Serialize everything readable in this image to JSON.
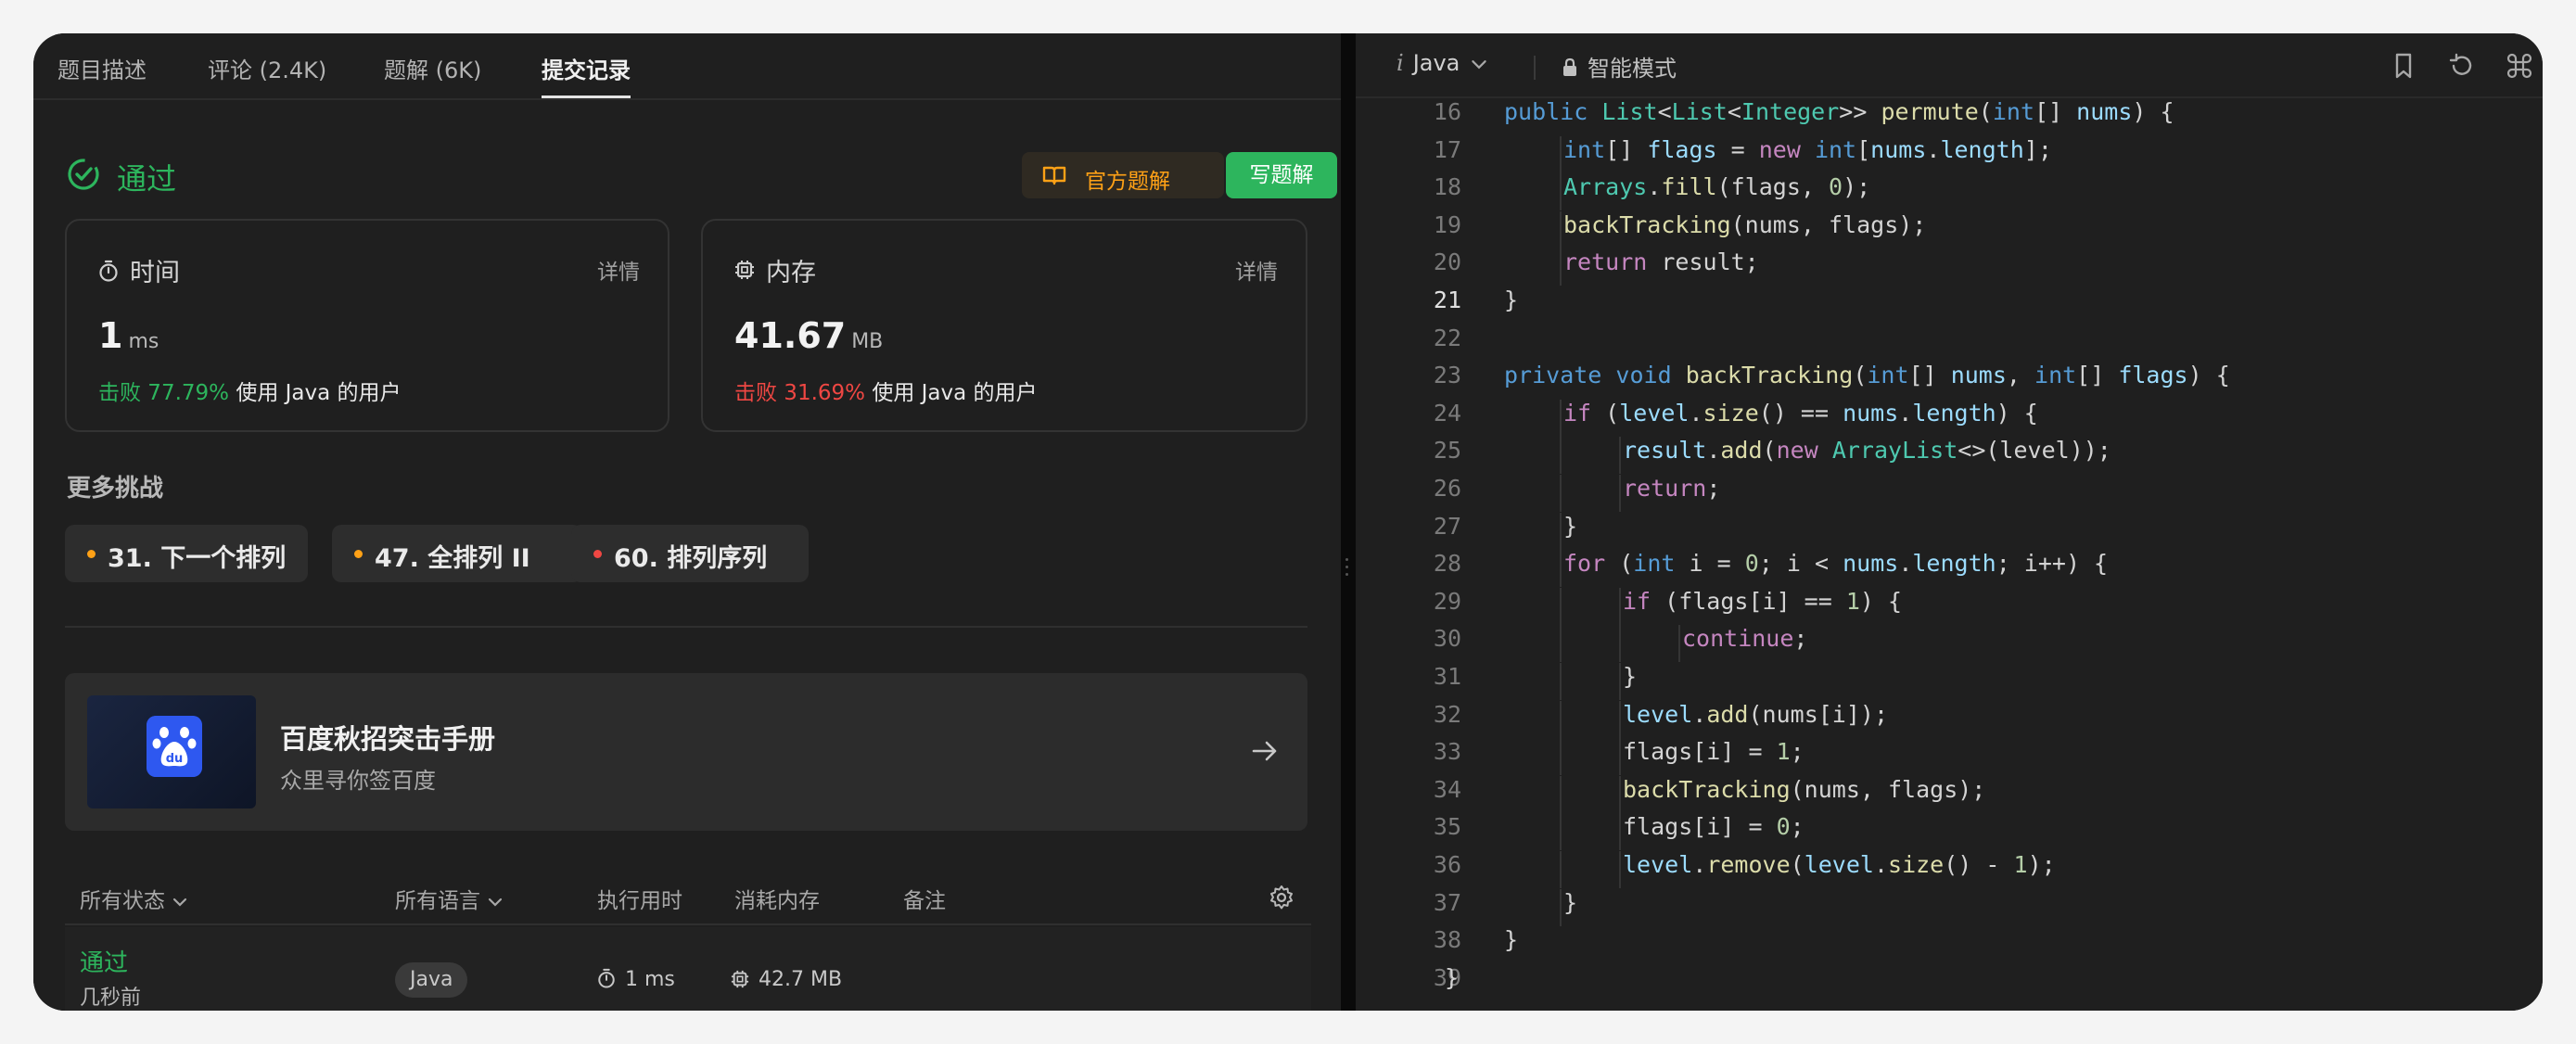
{
  "colors": {
    "accent_green": "#2db55d",
    "accent_orange": "#ffa116",
    "accent_red": "#ef4743",
    "panel": "#1f1f1f"
  },
  "left": {
    "tabs": [
      {
        "label": "题目描述"
      },
      {
        "label": "评论 (2.4K)"
      },
      {
        "label": "题解 (6K)"
      },
      {
        "label": "提交记录",
        "active": true
      }
    ],
    "status": {
      "icon": "check-circle-icon",
      "label": "通过"
    },
    "buttons": {
      "official": "官方题解",
      "official_icon": "book-icon",
      "write": "写题解"
    },
    "stats": {
      "time": {
        "icon": "stopwatch-icon",
        "label": "时间",
        "detail": "详情",
        "value": "1",
        "unit": "ms",
        "beat_label": "击败 77.79%",
        "beat_suffix": "使用 Java 的用户"
      },
      "memory": {
        "icon": "chip-icon",
        "label": "内存",
        "detail": "详情",
        "value": "41.67",
        "unit": "MB",
        "beat_label": "击败 31.69%",
        "beat_suffix": "使用 Java 的用户"
      }
    },
    "more": {
      "title": "更多挑战",
      "items": [
        {
          "label": "31. 下一个排列",
          "dot_color": "#ffa116"
        },
        {
          "label": "47. 全排列 II",
          "dot_color": "#ffa116"
        },
        {
          "label": "60. 排列序列",
          "dot_color": "#ef4743"
        }
      ]
    },
    "banner": {
      "title": "百度秋招突击手册",
      "subtitle": "众里寻你签百度",
      "logo_icon": "baidu-paw-icon",
      "arrow_icon": "arrow-right-icon"
    },
    "table": {
      "headers": {
        "status": "所有状态",
        "lang": "所有语言",
        "runtime": "执行用时",
        "memory": "消耗内存",
        "note": "备注"
      },
      "rows": [
        {
          "status": "通过",
          "time_ago": "几秒前",
          "lang": "Java",
          "runtime": "1 ms",
          "memory": "42.7 MB"
        }
      ]
    }
  },
  "editor": {
    "language": "Java",
    "mode": "智能模式",
    "current_line": 21,
    "lines": [
      {
        "n": "16",
        "indent": 1,
        "tokens": [
          [
            "public ",
            "t-prim"
          ],
          [
            "List",
            "t-type"
          ],
          [
            "<",
            "t-plain"
          ],
          [
            "List",
            "t-type"
          ],
          [
            "<",
            "t-plain"
          ],
          [
            "Integer",
            "t-type"
          ],
          [
            ">> ",
            "t-plain"
          ],
          [
            "permute",
            "t-func"
          ],
          [
            "(",
            "t-plain"
          ],
          [
            "int",
            "t-prim"
          ],
          [
            "[] ",
            "t-plain"
          ],
          [
            "nums",
            "t-var"
          ],
          [
            ") {",
            "t-plain"
          ]
        ]
      },
      {
        "n": "17",
        "indent": 2,
        "tokens": [
          [
            "int",
            "t-prim"
          ],
          [
            "[] ",
            "t-plain"
          ],
          [
            "flags",
            "t-var"
          ],
          [
            " = ",
            "t-plain"
          ],
          [
            "new ",
            "t-keyword"
          ],
          [
            "int",
            "t-prim"
          ],
          [
            "[",
            "t-plain"
          ],
          [
            "nums",
            "t-var"
          ],
          [
            ".",
            "t-plain"
          ],
          [
            "length",
            "t-var"
          ],
          [
            "];",
            "t-plain"
          ]
        ]
      },
      {
        "n": "18",
        "indent": 2,
        "tokens": [
          [
            "Arrays",
            "t-type"
          ],
          [
            ".",
            "t-plain"
          ],
          [
            "fill",
            "t-func"
          ],
          [
            "(flags, ",
            "t-plain"
          ],
          [
            "0",
            "t-num"
          ],
          [
            ");",
            "t-plain"
          ]
        ]
      },
      {
        "n": "19",
        "indent": 2,
        "tokens": [
          [
            "backTracking",
            "t-func"
          ],
          [
            "(nums, flags);",
            "t-plain"
          ]
        ]
      },
      {
        "n": "20",
        "indent": 2,
        "tokens": [
          [
            "return ",
            "t-keyword"
          ],
          [
            "result;",
            "t-plain"
          ]
        ]
      },
      {
        "n": "21",
        "indent": 1,
        "tokens": [
          [
            "}",
            "t-plain"
          ]
        ]
      },
      {
        "n": "22",
        "indent": 0,
        "tokens": []
      },
      {
        "n": "23",
        "indent": 1,
        "tokens": [
          [
            "private ",
            "t-prim"
          ],
          [
            "void ",
            "t-prim"
          ],
          [
            "backTracking",
            "t-func"
          ],
          [
            "(",
            "t-plain"
          ],
          [
            "int",
            "t-prim"
          ],
          [
            "[] ",
            "t-plain"
          ],
          [
            "nums",
            "t-var"
          ],
          [
            ", ",
            "t-plain"
          ],
          [
            "int",
            "t-prim"
          ],
          [
            "[] ",
            "t-plain"
          ],
          [
            "flags",
            "t-var"
          ],
          [
            ") {",
            "t-plain"
          ]
        ]
      },
      {
        "n": "24",
        "indent": 2,
        "tokens": [
          [
            "if ",
            "t-keyword"
          ],
          [
            "(",
            "t-plain"
          ],
          [
            "level",
            "t-var"
          ],
          [
            ".",
            "t-plain"
          ],
          [
            "size",
            "t-func"
          ],
          [
            "() == ",
            "t-plain"
          ],
          [
            "nums",
            "t-var"
          ],
          [
            ".",
            "t-plain"
          ],
          [
            "length",
            "t-var"
          ],
          [
            ") {",
            "t-plain"
          ]
        ]
      },
      {
        "n": "25",
        "indent": 3,
        "tokens": [
          [
            "result",
            "t-var"
          ],
          [
            ".",
            "t-plain"
          ],
          [
            "add",
            "t-func"
          ],
          [
            "(",
            "t-plain"
          ],
          [
            "new ",
            "t-keyword"
          ],
          [
            "ArrayList",
            "t-type"
          ],
          [
            "<>(level));",
            "t-plain"
          ]
        ]
      },
      {
        "n": "26",
        "indent": 3,
        "tokens": [
          [
            "return",
            "t-keyword"
          ],
          [
            ";",
            "t-plain"
          ]
        ]
      },
      {
        "n": "27",
        "indent": 2,
        "tokens": [
          [
            "}",
            "t-plain"
          ]
        ]
      },
      {
        "n": "28",
        "indent": 2,
        "tokens": [
          [
            "for ",
            "t-keyword"
          ],
          [
            "(",
            "t-plain"
          ],
          [
            "int ",
            "t-prim"
          ],
          [
            "i = ",
            "t-plain"
          ],
          [
            "0",
            "t-num"
          ],
          [
            "; i < ",
            "t-plain"
          ],
          [
            "nums",
            "t-var"
          ],
          [
            ".",
            "t-plain"
          ],
          [
            "length",
            "t-var"
          ],
          [
            "; i++) {",
            "t-plain"
          ]
        ]
      },
      {
        "n": "29",
        "indent": 3,
        "tokens": [
          [
            "if ",
            "t-keyword"
          ],
          [
            "(flags[i] == ",
            "t-plain"
          ],
          [
            "1",
            "t-num"
          ],
          [
            ") {",
            "t-plain"
          ]
        ]
      },
      {
        "n": "30",
        "indent": 4,
        "tokens": [
          [
            "continue",
            "t-keyword"
          ],
          [
            ";",
            "t-plain"
          ]
        ]
      },
      {
        "n": "31",
        "indent": 3,
        "tokens": [
          [
            "}",
            "t-plain"
          ]
        ]
      },
      {
        "n": "32",
        "indent": 3,
        "tokens": [
          [
            "level",
            "t-var"
          ],
          [
            ".",
            "t-plain"
          ],
          [
            "add",
            "t-func"
          ],
          [
            "(nums[i]);",
            "t-plain"
          ]
        ]
      },
      {
        "n": "33",
        "indent": 3,
        "tokens": [
          [
            "flags[i] = ",
            "t-plain"
          ],
          [
            "1",
            "t-num"
          ],
          [
            ";",
            "t-plain"
          ]
        ]
      },
      {
        "n": "34",
        "indent": 3,
        "tokens": [
          [
            "backTracking",
            "t-func"
          ],
          [
            "(nums, flags);",
            "t-plain"
          ]
        ]
      },
      {
        "n": "35",
        "indent": 3,
        "tokens": [
          [
            "flags[i] = ",
            "t-plain"
          ],
          [
            "0",
            "t-num"
          ],
          [
            ";",
            "t-plain"
          ]
        ]
      },
      {
        "n": "36",
        "indent": 3,
        "tokens": [
          [
            "level",
            "t-var"
          ],
          [
            ".",
            "t-plain"
          ],
          [
            "remove",
            "t-func"
          ],
          [
            "(",
            "t-plain"
          ],
          [
            "level",
            "t-var"
          ],
          [
            ".",
            "t-plain"
          ],
          [
            "size",
            "t-func"
          ],
          [
            "() - ",
            "t-plain"
          ],
          [
            "1",
            "t-num"
          ],
          [
            ");",
            "t-plain"
          ]
        ]
      },
      {
        "n": "37",
        "indent": 2,
        "tokens": [
          [
            "}",
            "t-plain"
          ]
        ]
      },
      {
        "n": "38",
        "indent": 1,
        "tokens": [
          [
            "}",
            "t-plain"
          ]
        ]
      },
      {
        "n": "39",
        "indent": 0,
        "tokens": [
          [
            "}",
            "t-plain"
          ]
        ]
      }
    ]
  }
}
